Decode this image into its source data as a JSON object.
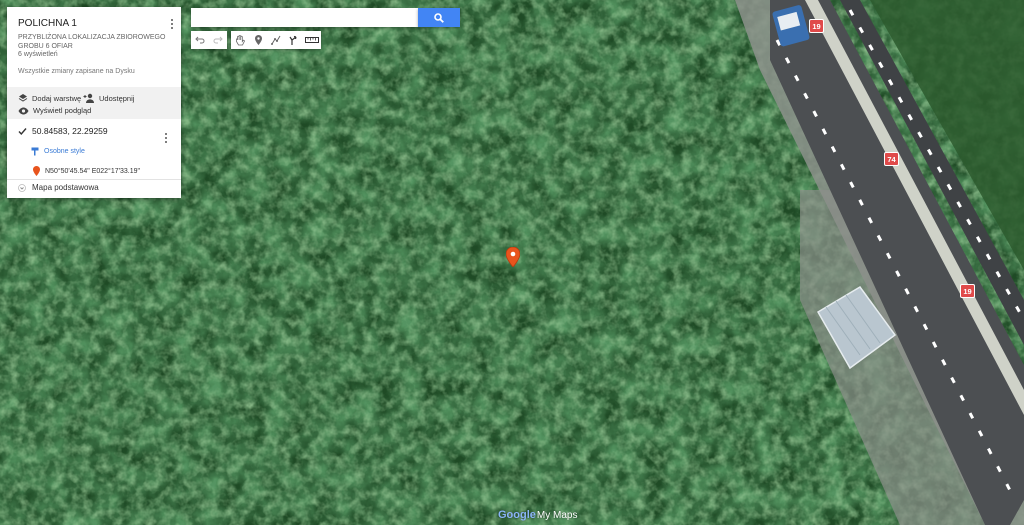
{
  "map": {
    "title": "POLICHNA 1",
    "description": "PRZYBLIŻONA LOKALIZACJA ZBIOROWEGO GROBU 6 OFIAR",
    "views": "6 wyświetleń",
    "saved_status": "Wszystkie zmiany zapisane na Dysku"
  },
  "actions": {
    "add_layer": "Dodaj warstwę",
    "share": "Udostępnij",
    "preview": "Wyświetl podgląd"
  },
  "layer": {
    "name": "50.84583, 22.29259",
    "checked": true,
    "style_label": "Osobne style",
    "point_label": "N50°50'45.54\" E022°17'33.19\""
  },
  "basemap": {
    "label": "Mapa podstawowa"
  },
  "search": {
    "placeholder": "",
    "value": ""
  },
  "toolbar": {
    "tools": [
      "undo-icon",
      "redo-icon",
      "hand-icon",
      "marker-icon",
      "draw-line-icon",
      "directions-icon",
      "ruler-icon"
    ]
  },
  "road_signs": [
    "19",
    "74",
    "19"
  ],
  "branding": {
    "logo_google": "Google",
    "logo_mymaps": "My Maps"
  },
  "colors": {
    "accent": "#4285f4",
    "marker": "#e8541d",
    "road_sign": "#e04a4a"
  }
}
